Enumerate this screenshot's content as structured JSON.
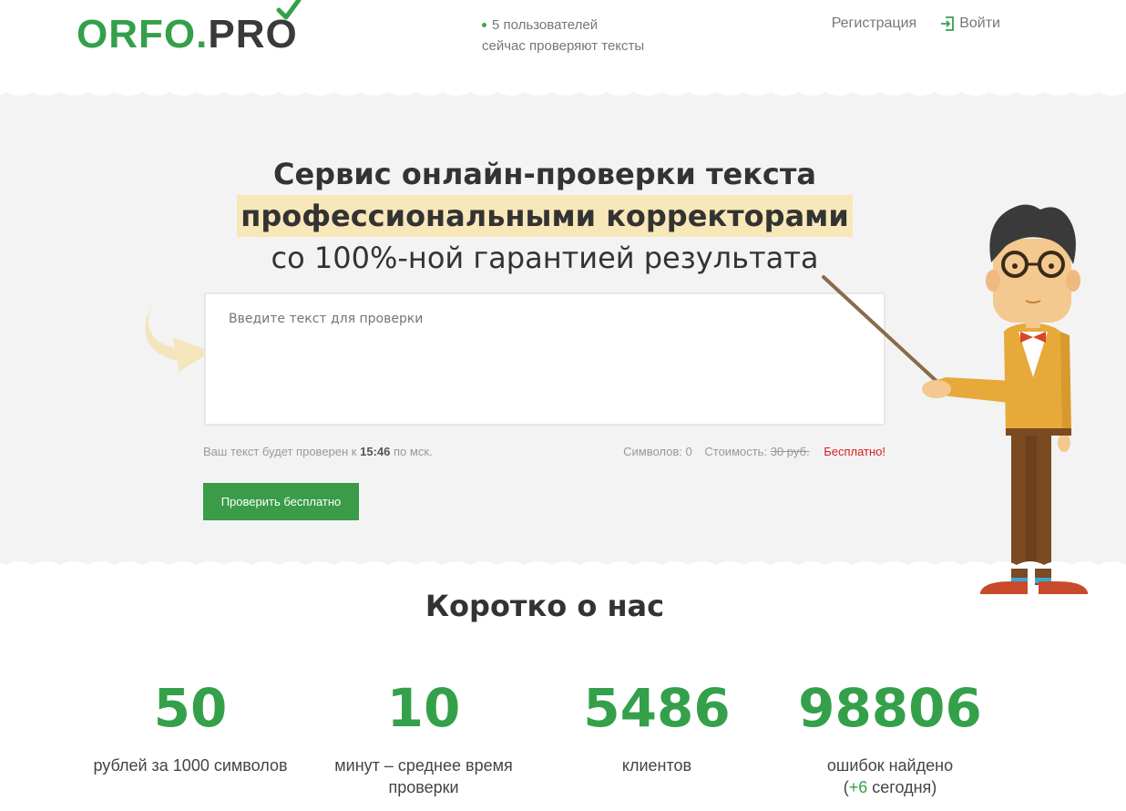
{
  "header": {
    "logo_left": "ORFO",
    "logo_dot": ".",
    "logo_pr": "PR",
    "logo_o": "O",
    "online_line1": "5 пользователей",
    "online_line2": "сейчас проверяют тексты",
    "register": "Регистрация",
    "login": "Войти"
  },
  "hero": {
    "title_line1": "Сервис онлайн-проверки текста",
    "title_line2": "профессиональными корректорами",
    "title_line3": "со 100%-ной гарантией результата",
    "textarea_placeholder": "Введите текст для проверки",
    "deadline_prefix": "Ваш текст будет проверен к",
    "deadline_time": "15:46",
    "deadline_suffix": "по мск.",
    "chars_label": "Символов: 0",
    "cost_label": "Стоимость:",
    "cost_old": "30 руб.",
    "cost_free": "Бесплатно!",
    "check_button": "Проверить бесплатно"
  },
  "about": {
    "title": "Коротко о нас",
    "stats": [
      {
        "number": "50",
        "label": "рублей за 1000 символов"
      },
      {
        "number": "10",
        "label": "минут – среднее время проверки"
      },
      {
        "number": "5486",
        "label": "клиентов"
      },
      {
        "number": "98806",
        "label": "ошибок найдено",
        "today_open": "(",
        "today_value": "+6",
        "today_suffix": " сегодня)"
      }
    ]
  },
  "colors": {
    "brand_green": "#34a04a",
    "button_green": "#3a9b48",
    "highlight": "#f8e7b8",
    "free_red": "#d62020"
  },
  "icons": [
    "check-icon",
    "login-icon",
    "curved-arrow-icon",
    "online-dot-icon"
  ]
}
